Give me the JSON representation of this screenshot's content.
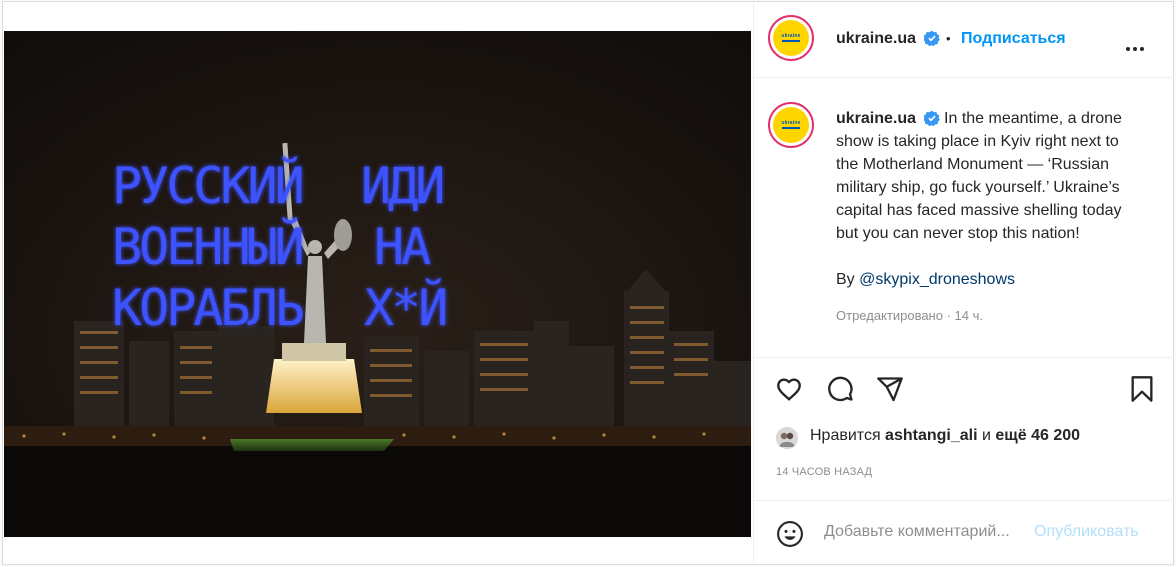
{
  "post": {
    "account": "ukraine.ua",
    "avatar_text": "ukraine",
    "follow_label": "Подписаться",
    "separator": "•",
    "caption_lines": [
      "In the meantime, a drone",
      "show is taking place in Kyiv right next to",
      "the Motherland Monument — ‘Russian",
      "military ship, go fuck yourself.’ Ukraine’s",
      "capital has faced massive shelling today",
      "but you can never stop this nation!"
    ],
    "byline_prefix": "By ",
    "byline_handle": "@skypix_droneshows",
    "edited_label": "Отредактировано",
    "edited_sep": " · ",
    "edited_time": "14 ч."
  },
  "photo": {
    "drone_text_left": [
      "РУССКИЙ",
      "ВОЕННЫЙ",
      "КОРАБЛЬ"
    ],
    "drone_text_right": [
      "ИДИ",
      "НА",
      "Х*Й"
    ]
  },
  "engagement": {
    "liked_prefix": "Нравится ",
    "liked_user": "ashtangi_ali",
    "liked_mid": " и ",
    "liked_count": "ещё 46 200",
    "timestamp": "14 ЧАСОВ НАЗАД"
  },
  "comment": {
    "placeholder": "Добавьте комментарий...",
    "publish_label": "Опубликовать"
  },
  "colors": {
    "accent": "#0095f6",
    "link": "#00376b",
    "muted": "#8e8e8e",
    "drone_blue": "#3d52ff",
    "avatar_yellow": "#ffd500",
    "avatar_blue": "#0057b7"
  },
  "icons": [
    "heart-icon",
    "comment-icon",
    "share-icon",
    "bookmark-icon",
    "emoji-icon",
    "verified-icon",
    "more-icon"
  ]
}
